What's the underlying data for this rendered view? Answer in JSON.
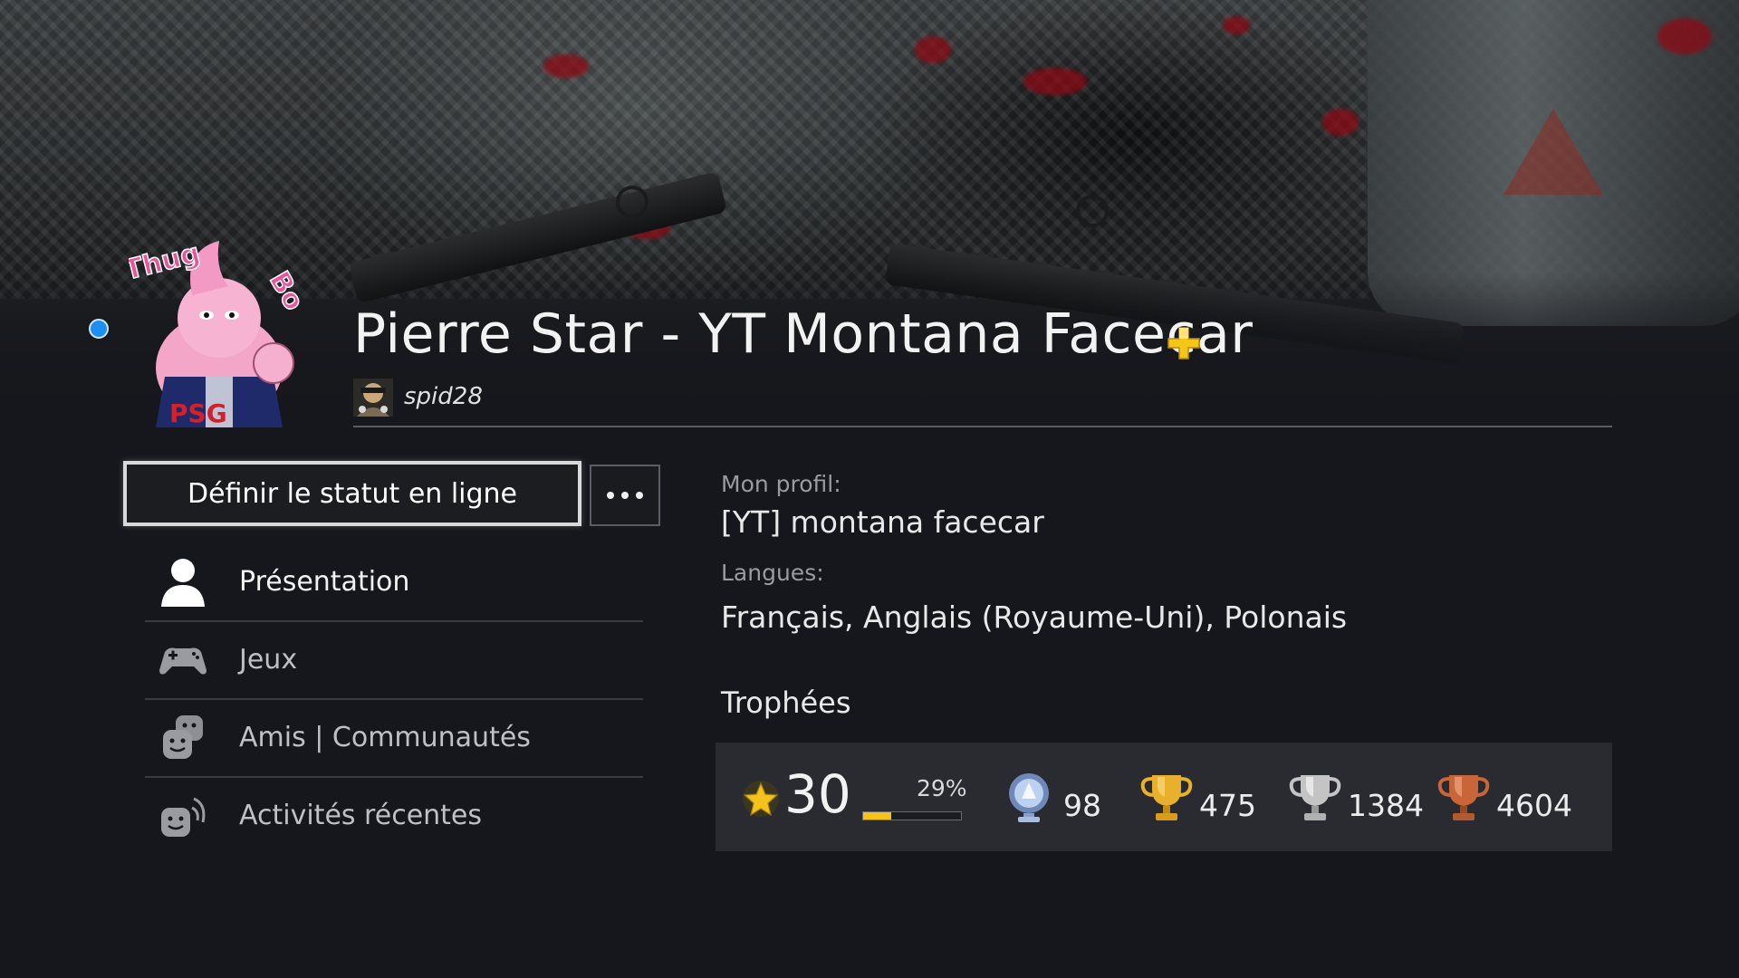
{
  "profile": {
    "name": "Pierre Star - YT Montana Facecar",
    "psn_id": "spid28",
    "online_color": "#1e8ef0",
    "plus_color": "#f5c518"
  },
  "actions": {
    "status_button": "Définir le statut en ligne",
    "more_icon": "more-options-icon"
  },
  "menu": [
    {
      "label": "Présentation",
      "icon": "person-icon",
      "active": true
    },
    {
      "label": "Jeux",
      "icon": "gamepad-icon",
      "active": false
    },
    {
      "label": "Amis | Communautés",
      "icon": "friends-icon",
      "active": false
    },
    {
      "label": "Activités récentes",
      "icon": "activity-icon",
      "active": false
    }
  ],
  "about": {
    "profile_label": "Mon profil:",
    "profile_value": "[YT] montana facecar",
    "languages_label": "Langues:",
    "languages_value": "Français, Anglais (Royaume-Uni), Polonais"
  },
  "trophies": {
    "heading": "Trophées",
    "level": "30",
    "progress_percent": 29,
    "progress_label": "29%",
    "platinum": "98",
    "gold": "475",
    "silver": "1384",
    "bronze": "4604",
    "colors": {
      "accent": "#f3c21b",
      "platinum": "#9fb8e0",
      "gold": "#e0a524",
      "silver": "#c9c9c9",
      "bronze": "#c8663a"
    }
  }
}
